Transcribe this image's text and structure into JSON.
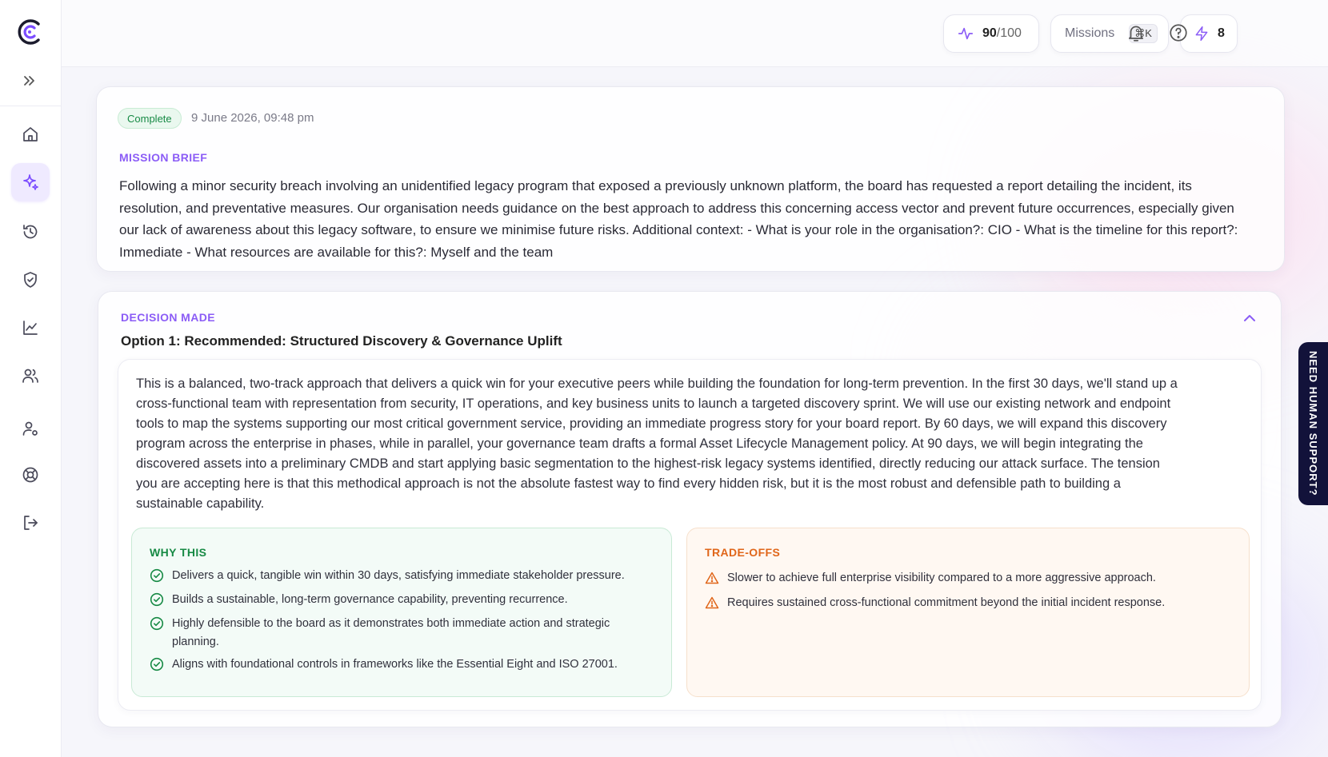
{
  "topbar": {
    "score_value": "90",
    "score_total": "/100",
    "missions_label": "Missions",
    "missions_shortcut": "⌘K",
    "credits": "8"
  },
  "brief": {
    "status": "Complete",
    "timestamp": "9 June 2026, 09:48 pm",
    "label": "MISSION BRIEF",
    "text": "Following a minor security breach involving an unidentified legacy program that exposed a previously unknown platform, the board has requested a report detailing the incident, its resolution, and preventative measures. Our organisation needs guidance on the best approach to address this concerning access vector and prevent future occurrences, especially given our lack of awareness about this legacy software, to ensure we minimise future risks. Additional context: - What is your role in the organisation?: CIO - What is the timeline for this report?: Immediate - What resources are available for this?: Myself and the team"
  },
  "decision": {
    "label": "DECISION MADE",
    "option_title": "Option 1: Recommended: Structured Discovery & Governance Uplift",
    "description": "This is a balanced, two-track approach that delivers a quick win for your executive peers while building the foundation for long-term prevention. In the first 30 days, we'll stand up a cross-functional team with representation from security, IT operations, and key business units to launch a targeted discovery sprint. We will use our existing network and endpoint tools to map the systems supporting our most critical government service, providing an immediate progress story for your board report. By 60 days, we will expand this discovery program across the enterprise in phases, while in parallel, your governance team drafts a formal Asset Lifecycle Management policy. At 90 days, we will begin integrating the discovered assets into a preliminary CMDB and start applying basic segmentation to the highest-risk legacy systems identified, directly reducing our attack surface. The tension you are accepting here is that this methodical approach is not the absolute fastest way to find every hidden risk, but it is the most robust and defensible path to building a sustainable capability.",
    "why_label": "WHY THIS",
    "why_items": [
      "Delivers a quick, tangible win within 30 days, satisfying immediate stakeholder pressure.",
      "Builds a sustainable, long-term governance capability, preventing recurrence.",
      "Highly defensible to the board as it demonstrates both immediate action and strategic planning.",
      "Aligns with foundational controls in frameworks like the Essential Eight and ISO 27001."
    ],
    "tradeoffs_label": "TRADE-OFFS",
    "tradeoff_items": [
      "Slower to achieve full enterprise visibility compared to a more aggressive approach.",
      "Requires sustained cross-functional commitment beyond the initial incident response."
    ]
  },
  "support": {
    "label": "NEED HUMAN SUPPORT?"
  },
  "colors": {
    "accent": "#8b5cf6",
    "success": "#178a45",
    "warning": "#e0661a",
    "support_bg": "#12123a"
  }
}
